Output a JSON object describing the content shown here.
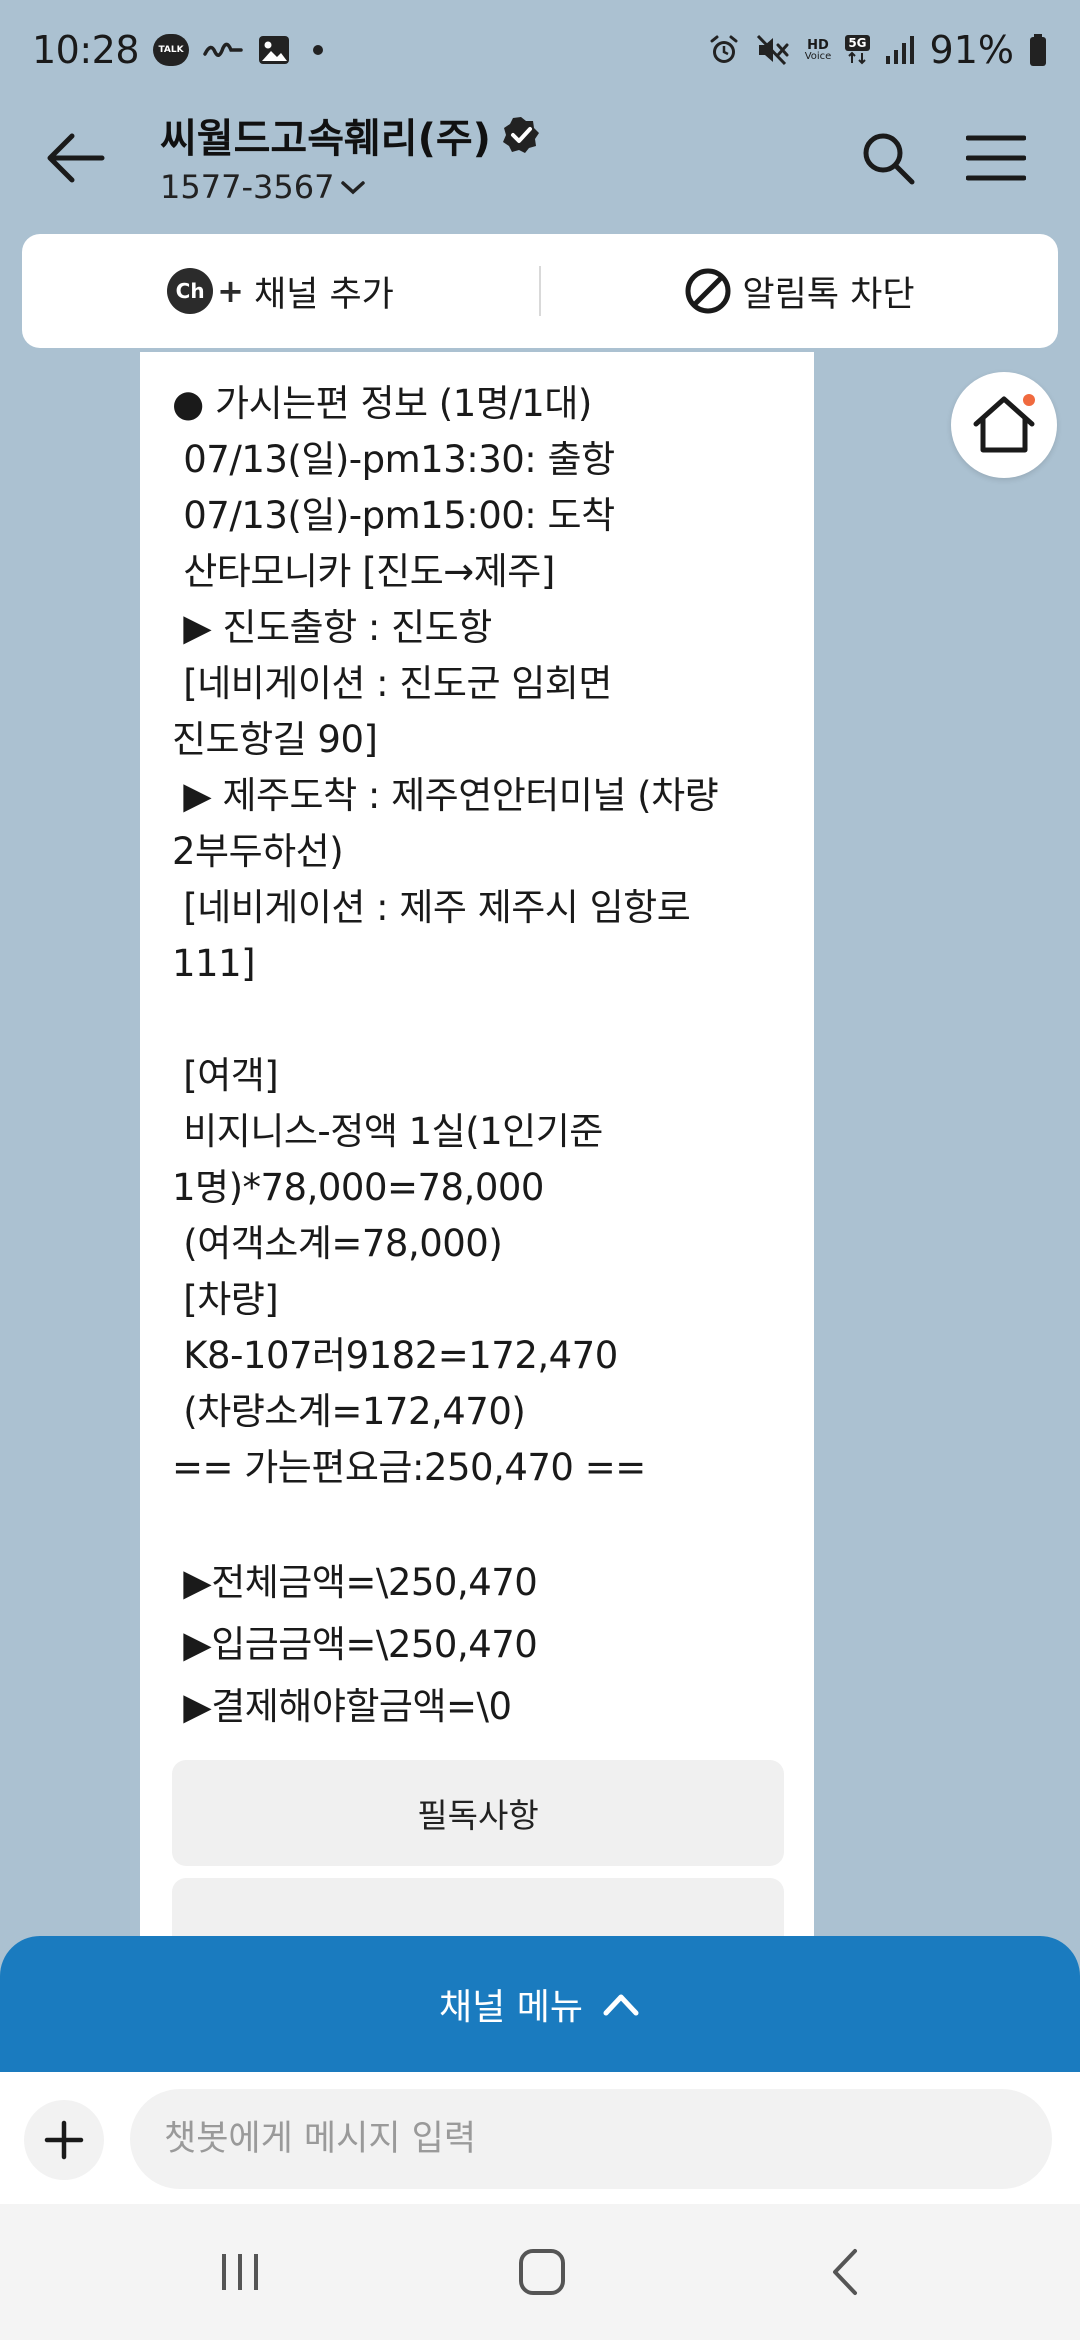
{
  "status_bar": {
    "time": "10:28",
    "talk_label": "TALK",
    "hd_label": "HD",
    "voice_label": "Voice",
    "network_label": "5G",
    "battery": "91%"
  },
  "header": {
    "title": "씨월드고속훼리(주)",
    "phone": "1577-3567"
  },
  "actions": {
    "add_channel": "채널 추가",
    "ch_badge": "Ch",
    "block_alimtalk": "알림톡 차단"
  },
  "message": {
    "lines": [
      "● 가시는편 정보 (1명/1대)",
      " 07/13(일)-pm13:30: 출항",
      " 07/13(일)-pm15:00: 도착",
      " 산타모니카 [진도→제주]",
      " ▶ 진도출항 : 진도항",
      " [네비게이션 : 진도군 임회면",
      "진도항길 90]",
      " ▶ 제주도착 : 제주연안터미널 (차량",
      "2부두하선)",
      " [네비게이션 : 제주 제주시 임항로",
      "111]",
      "",
      " [여객]",
      " 비지니스-정액 1실(1인기준",
      "1명)*78,000=78,000",
      " (여객소계=78,000)",
      " [차량]",
      " K8-107러9182=172,470",
      " (차량소계=172,470)",
      "== 가는편요금:250,470 =="
    ],
    "summary": [
      " ▶전체금액=\\250,470",
      " ▶입금금액=\\250,470",
      " ▶결제해야할금액=\\0"
    ],
    "notice_button": "필독사항"
  },
  "channel_menu": {
    "label": "채널 메뉴"
  },
  "input": {
    "placeholder": "챗봇에게 메시지 입력"
  },
  "colors": {
    "background": "#abc1d1",
    "channel_menu": "#1a7bbf",
    "home_dot": "#f06a3f"
  }
}
